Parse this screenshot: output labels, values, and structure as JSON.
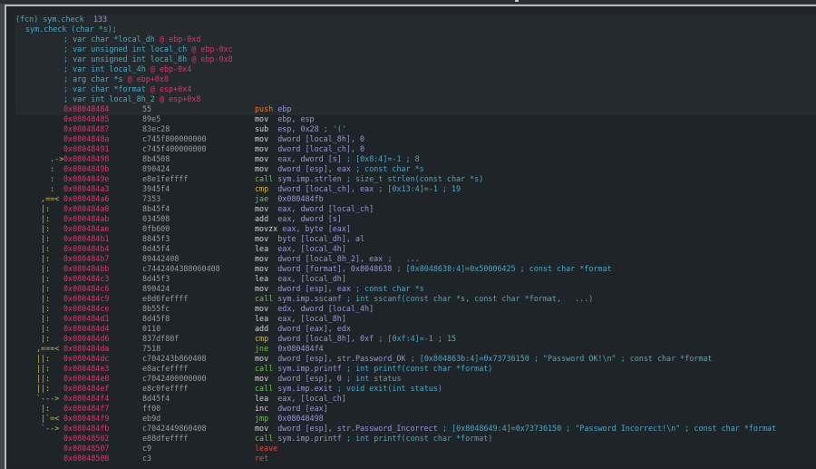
{
  "header": {
    "fcn_line": {
      "a": "(fcn) sym.check",
      "b": "133"
    },
    "sig_line": "sym.check (char *s);",
    "vars": [
      {
        "pre": "; var char *local_dh",
        "at": "@ ebp-0xd"
      },
      {
        "pre": "; var unsigned int local_ch",
        "at": "@ ebp-0xc"
      },
      {
        "pre": "; var unsigned int local_8h",
        "at": "@ ebp-0x8"
      },
      {
        "pre": "; var int local_4h",
        "at": "@ ebp-0x4"
      },
      {
        "pre": "; arg char *s",
        "at": "@ ebp+0x8"
      },
      {
        "pre": "; var char *format",
        "at": "@ esp+0x4"
      },
      {
        "pre": "; var int local_8h_2",
        "at": "@ esp+0x8"
      }
    ]
  },
  "rows": [
    {
      "flow": "",
      "addr": "0x08048484",
      "bytes": "55",
      "mnem": "push",
      "mnem_color": "or",
      "ops": "ebp",
      "cmt": ""
    },
    {
      "flow": "",
      "addr": "0x08048485",
      "bytes": "89e5",
      "mnem": "mov",
      "mnem_color": "wh",
      "ops": "ebp, esp",
      "cmt": ""
    },
    {
      "flow": "",
      "addr": "0x08048487",
      "bytes": "83ec28",
      "mnem": "sub",
      "mnem_color": "wh",
      "ops": "esp, 0x28",
      "cmt": "; '('"
    },
    {
      "flow": "",
      "addr": "0x0804848a",
      "bytes": "c745f800000000",
      "mnem": "mov",
      "mnem_color": "wh",
      "ops": "dword [local_8h], 0",
      "cmt": ""
    },
    {
      "flow": "",
      "addr": "0x08048491",
      "bytes": "c745f400000000",
      "mnem": "mov",
      "mnem_color": "wh",
      "ops": "dword [local_ch], 0",
      "cmt": ""
    },
    {
      "flow": "   .->",
      "addr": "0x08048498",
      "bytes": "8b4508",
      "mnem": "mov",
      "mnem_color": "wh",
      "ops": "eax, dword [s]",
      "cmt": "; [0x8:4]=-1 ; 8"
    },
    {
      "flow": "   :",
      "addr": "0x0804849b",
      "bytes": "890424",
      "mnem": "mov",
      "mnem_color": "wh",
      "ops": "dword [esp], eax",
      "cmt": "; const char *s"
    },
    {
      "flow": "   :",
      "addr": "0x0804849e",
      "bytes": "e8e1feffff",
      "mnem": "call",
      "mnem_color": "gn",
      "ops": "sym.imp.strlen",
      "cmt": "; size_t strlen(const char *s)"
    },
    {
      "flow": "   :",
      "addr": "0x080484a3",
      "bytes": "3945f4",
      "mnem": "cmp",
      "mnem_color": "yl",
      "ops": "dword [local_ch], eax",
      "cmt": "; [0x13:4]=-1 ; 19"
    },
    {
      "flow": " ,==<",
      "addr": "0x080484a6",
      "bytes": "7353",
      "mnem": "jae",
      "mnem_color": "gn",
      "ops": "0x080484fb",
      "cmt": ""
    },
    {
      "flow": " |:",
      "addr": "0x080484a8",
      "bytes": "8b45f4",
      "mnem": "mov",
      "mnem_color": "wh",
      "ops": "eax, dword [local_ch]",
      "cmt": ""
    },
    {
      "flow": " |:",
      "addr": "0x080484ab",
      "bytes": "034508",
      "mnem": "add",
      "mnem_color": "wh",
      "ops": "eax, dword [s]",
      "cmt": ""
    },
    {
      "flow": " |:",
      "addr": "0x080484ae",
      "bytes": "0fb600",
      "mnem": "movzx",
      "mnem_color": "wh",
      "ops": "eax, byte [eax]",
      "cmt": ""
    },
    {
      "flow": " |:",
      "addr": "0x080484b1",
      "bytes": "8845f3",
      "mnem": "mov",
      "mnem_color": "wh",
      "ops": "byte [local_dh], al",
      "cmt": ""
    },
    {
      "flow": " |:",
      "addr": "0x080484b4",
      "bytes": "8d45f4",
      "mnem": "lea",
      "mnem_color": "wh",
      "ops": "eax, [local_4h]",
      "cmt": ""
    },
    {
      "flow": " |:",
      "addr": "0x080484b7",
      "bytes": "89442408",
      "mnem": "mov",
      "mnem_color": "wh",
      "ops": "dword [local_8h_2], eax",
      "cmt": ";   ..."
    },
    {
      "flow": " |:",
      "addr": "0x080484bb",
      "bytes": "c7442404388060408",
      "mnem": "mov",
      "mnem_color": "wh",
      "ops": "dword [format], 0x8048638",
      "cmt": "; [0x8048638:4]=0x50006425 ; const char *format"
    },
    {
      "flow": " |:",
      "addr": "0x080484c3",
      "bytes": "8d45f3",
      "mnem": "lea",
      "mnem_color": "wh",
      "ops": "eax, [local_dh]",
      "cmt": ""
    },
    {
      "flow": " |:",
      "addr": "0x080484c6",
      "bytes": "890424",
      "mnem": "mov",
      "mnem_color": "wh",
      "ops": "dword [esp], eax",
      "cmt": "; const char *s"
    },
    {
      "flow": " |:",
      "addr": "0x080484c9",
      "bytes": "e8d6feffff",
      "mnem": "call",
      "mnem_color": "gn",
      "ops": "sym.imp.sscanf",
      "cmt": "; int sscanf(const char *s, const char *format,   ...)"
    },
    {
      "flow": " |:",
      "addr": "0x080484ce",
      "bytes": "8b55fc",
      "mnem": "mov",
      "mnem_color": "wh",
      "ops": "edx, dword [local_4h]",
      "cmt": ""
    },
    {
      "flow": " |:",
      "addr": "0x080484d1",
      "bytes": "8d45f8",
      "mnem": "lea",
      "mnem_color": "wh",
      "ops": "eax, [local_8h]",
      "cmt": ""
    },
    {
      "flow": " |:",
      "addr": "0x080484d4",
      "bytes": "0110",
      "mnem": "add",
      "mnem_color": "wh",
      "ops": "dword [eax], edx",
      "cmt": ""
    },
    {
      "flow": " |:",
      "addr": "0x080484d6",
      "bytes": "837df80f",
      "mnem": "cmp",
      "mnem_color": "yl",
      "ops": "dword [local_8h], 0xf",
      "cmt": "; [0xf:4]=-1 ; 15"
    },
    {
      "flow": ",===<",
      "addr": "0x080484da",
      "bytes": "7518",
      "mnem": "jne",
      "mnem_color": "gn",
      "ops": "0x080484f4",
      "cmt": ""
    },
    {
      "flow": "||:",
      "addr": "0x080484dc",
      "bytes": "c704243b860408",
      "mnem": "mov",
      "mnem_color": "wh",
      "ops": "dword [esp], str.Password_OK",
      "cmt": "; [0x804863b:4]=0x73736150 ; \"Password OK!\\n\" ; const char *format"
    },
    {
      "flow": "||:",
      "addr": "0x080484e3",
      "bytes": "e8acfeffff",
      "mnem": "call",
      "mnem_color": "gn",
      "ops": "sym.imp.printf",
      "cmt": "; int printf(const char *format)"
    },
    {
      "flow": "||:",
      "addr": "0x080484e8",
      "bytes": "c7042400000000",
      "mnem": "mov",
      "mnem_color": "wh",
      "ops": "dword [esp], 0",
      "cmt": "; int status"
    },
    {
      "flow": "||:",
      "addr": "0x080484ef",
      "bytes": "e8c0feffff",
      "mnem": "call",
      "mnem_color": "gn",
      "ops": "sym.imp.exit",
      "cmt": "; void exit(int status)"
    },
    {
      "flow": "`--->",
      "addr": "0x080484f4",
      "bytes": "8d45f4",
      "mnem": "lea",
      "mnem_color": "wh",
      "ops": "eax, [local_ch]",
      "cmt": ""
    },
    {
      "flow": " |:",
      "addr": "0x080484f7",
      "bytes": "ff00",
      "mnem": "inc",
      "mnem_color": "wh",
      "ops": "dword [eax]",
      "cmt": ""
    },
    {
      "flow": " |`=<",
      "addr": "0x080484f9",
      "bytes": "eb9d",
      "mnem": "jmp",
      "mnem_color": "gn",
      "ops": "0x08048498",
      "cmt": ""
    },
    {
      "flow": " `-->",
      "addr": "0x080484fb",
      "bytes": "c7042449860408",
      "mnem": "mov",
      "mnem_color": "wh",
      "ops": "dword [esp], str.Password_Incorrect",
      "cmt": "; [0x8048649:4]=0x73736150 ; \"Password Incorrect!\\n\" ; const char *format"
    },
    {
      "flow": "",
      "addr": "0x08048502",
      "bytes": "e88dfeffff",
      "mnem": "call",
      "mnem_color": "gn",
      "ops": "sym.imp.printf",
      "cmt": "; int printf(const char *format)"
    },
    {
      "flow": "",
      "addr": "0x08048507",
      "bytes": "c9",
      "mnem": "leave",
      "mnem_color": "rd",
      "ops": "",
      "cmt": ""
    },
    {
      "flow": "",
      "addr": "0x08048508",
      "bytes": "c3",
      "mnem": "ret",
      "mnem_color": "rd",
      "ops": "",
      "cmt": ""
    }
  ]
}
